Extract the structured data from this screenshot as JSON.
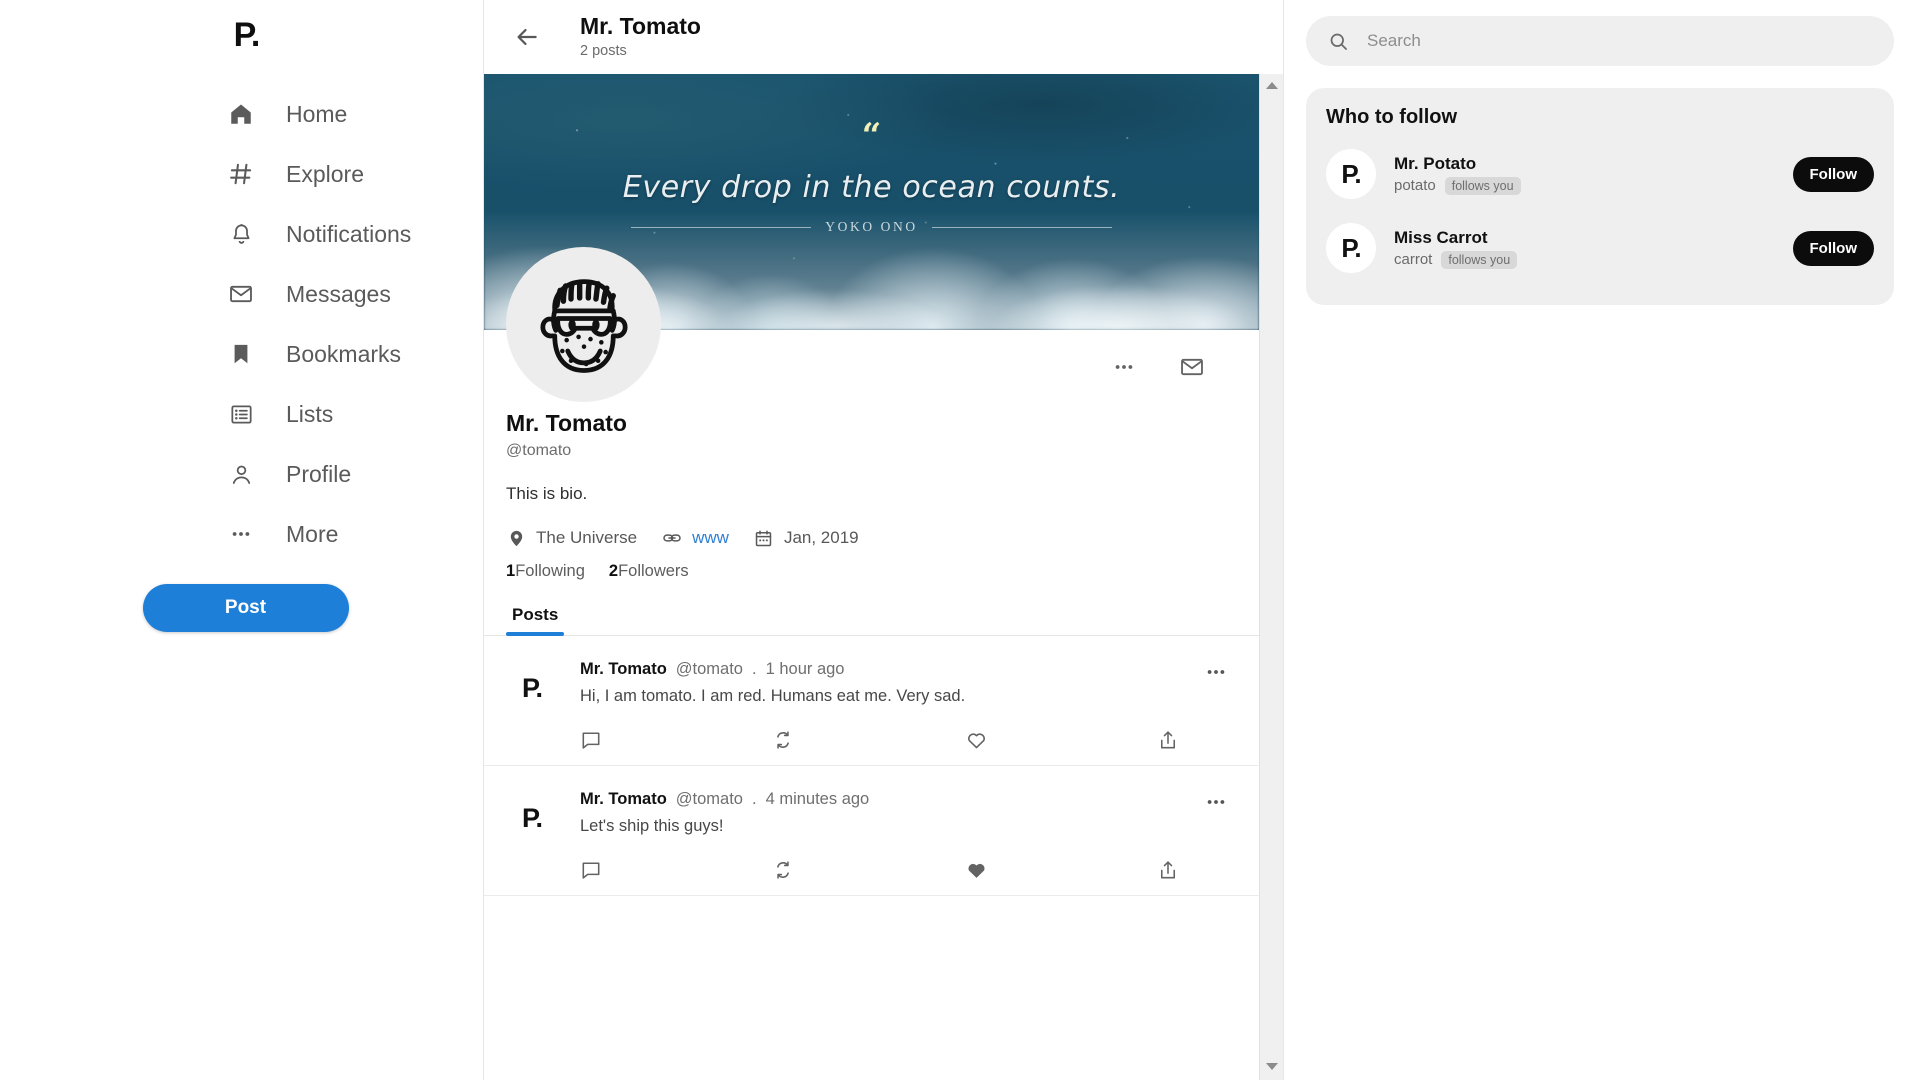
{
  "brand": {
    "logo": "P."
  },
  "sidebar": {
    "items": [
      {
        "label": "Home",
        "icon": "home-icon"
      },
      {
        "label": "Explore",
        "icon": "hashtag-icon"
      },
      {
        "label": "Notifications",
        "icon": "bell-icon"
      },
      {
        "label": "Messages",
        "icon": "envelope-icon"
      },
      {
        "label": "Bookmarks",
        "icon": "bookmark-icon"
      },
      {
        "label": "Lists",
        "icon": "list-icon"
      },
      {
        "label": "Profile",
        "icon": "person-icon"
      },
      {
        "label": "More",
        "icon": "ellipsis-icon"
      }
    ],
    "post_button": "Post"
  },
  "header": {
    "back_icon": "arrow-left-icon",
    "title": "Mr. Tomato",
    "subtitle": "2 posts"
  },
  "banner": {
    "quote_mark": "“",
    "quote": "Every drop in the ocean counts.",
    "attribution": "YOKO ONO"
  },
  "profile": {
    "name": "Mr. Tomato",
    "handle": "@tomato",
    "bio": "This is bio.",
    "location": "The Universe",
    "website": "www",
    "joined": "Jan, 2019",
    "following_count": "1",
    "following_label": "Following",
    "followers_count": "2",
    "followers_label": "Followers",
    "actions": [
      {
        "icon": "ellipsis-icon",
        "name": "profile-more-button"
      },
      {
        "icon": "envelope-icon",
        "name": "profile-message-button"
      }
    ]
  },
  "tabs": [
    {
      "label": "Posts",
      "active": true
    }
  ],
  "posts": [
    {
      "avatar": "P.",
      "author": "Mr. Tomato",
      "handle": "@tomato",
      "separator": ".",
      "time": "1 hour ago",
      "text": "Hi, I am tomato. I am red. Humans eat me. Very sad.",
      "liked": false
    },
    {
      "avatar": "P.",
      "author": "Mr. Tomato",
      "handle": "@tomato",
      "separator": ".",
      "time": "4 minutes ago",
      "text": "Let's ship this guys!",
      "liked": true
    }
  ],
  "search": {
    "placeholder": "Search",
    "value": "",
    "icon": "search-icon"
  },
  "who_to_follow": {
    "title": "Who to follow",
    "people": [
      {
        "avatar": "P.",
        "name": "Mr. Potato",
        "handle": "potato",
        "badge": "follows you",
        "button": "Follow"
      },
      {
        "avatar": "P.",
        "name": "Miss Carrot",
        "handle": "carrot",
        "badge": "follows you",
        "button": "Follow"
      }
    ]
  },
  "colors": {
    "accent_blue": "#1d7fd8",
    "link_blue": "#2f7fd4",
    "follow_black": "#0c0c0c",
    "panel_gray": "#efefef"
  }
}
